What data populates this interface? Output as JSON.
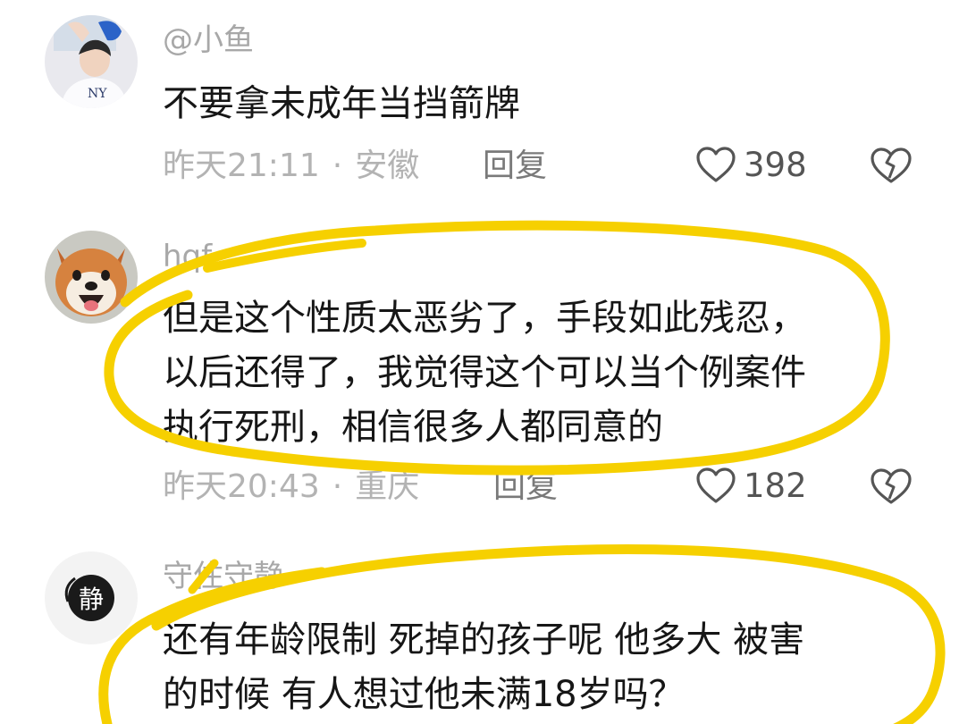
{
  "comments": [
    {
      "username": "@小鱼",
      "text_lines": [
        "不要拿未成年当挡箭牌"
      ],
      "time": "昨天21:11",
      "separator": "·",
      "location": "安徽",
      "reply_label": "回复",
      "likes": "398",
      "avatar": "person-photo"
    },
    {
      "username": "hqf",
      "text_lines": [
        "但是这个性质太恶劣了，手段如此残忍，",
        "以后还得了，我觉得这个可以当个例案件",
        "执行死刑，相信很多人都同意的"
      ],
      "time": "昨天20:43",
      "separator": "·",
      "location": "重庆",
      "reply_label": "回复",
      "likes": "182",
      "avatar": "shiba-dog-photo"
    },
    {
      "username": "守住守静",
      "text_lines": [
        "还有年龄限制  死掉的孩子呢 他多大   被害",
        "的时候 有人想过他未满18岁吗？"
      ],
      "avatar": "jing-calligraphy-logo",
      "avatar_glyph": "静"
    }
  ],
  "icons": {
    "like": "heart-outline-icon",
    "dislike": "broken-heart-icon"
  },
  "colors": {
    "highlight_marker": "#f6d000",
    "text": "#161616",
    "meta": "#b3b3b3"
  }
}
